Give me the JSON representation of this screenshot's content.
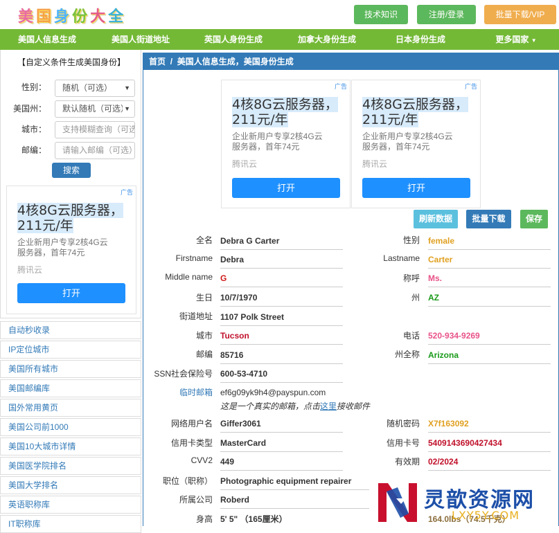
{
  "header": {
    "logo": [
      "美",
      "国",
      "身",
      "份",
      "大",
      "全"
    ],
    "buttons": {
      "tech": "技术知识",
      "login": "注册/登录",
      "batch_vip": "批量下载/VIP"
    }
  },
  "nav": [
    "美国人信息生成",
    "美国人街道地址",
    "英国人身份生成",
    "加拿大身份生成",
    "日本身份生成",
    "更多国家"
  ],
  "sidebar": {
    "form_title": "【自定义条件生成美国身份】",
    "gender_label": "性别：",
    "gender_value": "随机（可选）",
    "state_label": "美国州：",
    "state_value": "默认随机（可选）",
    "city_label": "城市：",
    "city_placeholder": "支持模糊查询（可选）",
    "zip_label": "邮编：",
    "zip_placeholder": "请输入邮编（可选）",
    "search_btn": "搜索",
    "links": [
      "自动秒收录",
      "IP定位城市",
      "美国所有城市",
      "美国邮编库",
      "国外常用黄页",
      "美国公司前1000",
      "美国10大城市详情",
      "美国医学院排名",
      "美国大学排名",
      "英语职称库",
      "IT职称库"
    ]
  },
  "ad": {
    "tag": "广告",
    "title_line1": "4核8G云服务器，",
    "title_line2": "211元/年",
    "desc_line1": "企业新用户专享2核4G云",
    "desc_line2": "服务器，首年74元",
    "source": "腾讯云",
    "button": "打开"
  },
  "main": {
    "breadcrumb_home": "首页",
    "breadcrumb_sep": "/",
    "breadcrumb_current": "美国人信息生成，美国身份生成",
    "actions": {
      "refresh": "刷新数据",
      "batch": "批量下载",
      "save": "保存"
    },
    "fields": {
      "fullname_label": "全名",
      "fullname": "Debra G Carter",
      "gender_label": "性别",
      "gender": "female",
      "firstname_label": "Firstname",
      "firstname": "Debra",
      "lastname_label": "Lastname",
      "lastname": "Carter",
      "middle_label": "Middle name",
      "middle": "G",
      "title_label": "称呼",
      "title": "Ms.",
      "birthday_label": "生日",
      "birthday": "10/7/1970",
      "state_label": "州",
      "state": "AZ",
      "street_label": "街道地址",
      "street": "1107 Polk Street",
      "city_label": "城市",
      "city": "Tucson",
      "phone_label": "电话",
      "phone": "520-934-9269",
      "zip_label": "邮编",
      "zip": "85716",
      "state_full_label": "州全称",
      "state_full": "Arizona",
      "ssn_label": "SSN社会保险号",
      "ssn": "600-53-4710",
      "temp_email_label": "临时邮箱",
      "temp_email": "ef6g09yk9h4@payspun.com",
      "email_note_pre": "这是一个真实的邮箱，点击",
      "email_note_link": "这里",
      "email_note_post": "接收邮件",
      "username_label": "网络用户名",
      "username": "Giffer3061",
      "password_label": "随机密码",
      "password": "X7f163092",
      "cardtype_label": "信用卡类型",
      "cardtype": "MasterCard",
      "cardnum_label": "信用卡号",
      "cardnum": "5409143690427434",
      "cvv_label": "CVV2",
      "cvv": "449",
      "expiry_label": "有效期",
      "expiry": "02/2024",
      "job_label": "职位（职称）",
      "job": "Photographic equipment repairer",
      "company_label": "所属公司",
      "company": "Roberd",
      "height_label": "身高",
      "height": "5' 5\" （165厘米）",
      "weight": "164.0lbs（74.5千克）"
    }
  },
  "watermark": {
    "text": "灵歆资源网",
    "url": "LXY5Y.COM"
  }
}
